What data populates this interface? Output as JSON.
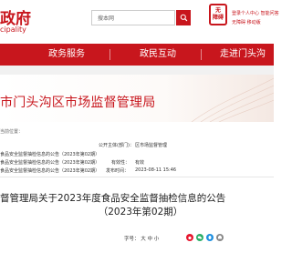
{
  "header": {
    "site_title": "政府",
    "site_title_prefix": "政府",
    "site_subtitle": "cipality",
    "search_scope": "搜本网",
    "search_placeholder": "",
    "app_badge_line1": "无",
    "app_badge_line2": "障碍",
    "user_links": "登录个人中心  智能问答",
    "user_links_2": "无障碍  移动版"
  },
  "nav": {
    "items": [
      {
        "label": "政务服务"
      },
      {
        "label": "政民互动"
      },
      {
        "label": "走进门头沟"
      }
    ]
  },
  "department": {
    "title": "市门头沟区市场监督管理局"
  },
  "breadcrumb": "当前位置：",
  "meta": {
    "publisher_label": "公开主体(部门)：",
    "publisher_value": "区市场监督管理",
    "doc_label_left": "食品安全监督抽检信息的公告（2023年第02期）",
    "doc_label_right": "（2023年第02期）",
    "row2_left": "食品安全监督抽检信息的公告（2023年第02期）",
    "validity_label": "有效性：",
    "validity_value": "有效",
    "row3_left": "食品安全监督抽检信息的公告（2023年第02期）",
    "date_label": "发布时间：",
    "date_value": "2023-08-11 15:46"
  },
  "article": {
    "title_line1": "督管理局关于2023年度食品安全监督抽检信息的公告",
    "title_line2": "（2023年第02期）"
  },
  "share": {
    "font_size_text": "字号：  大  中  小",
    "colors": {
      "weibo": "#e6162d",
      "wechat": "#2aae67",
      "qq": "#1f90e0",
      "print": "#888888"
    }
  },
  "colors": {
    "brand_red": "#c8161d",
    "content_bg": "#f1f1f1"
  }
}
